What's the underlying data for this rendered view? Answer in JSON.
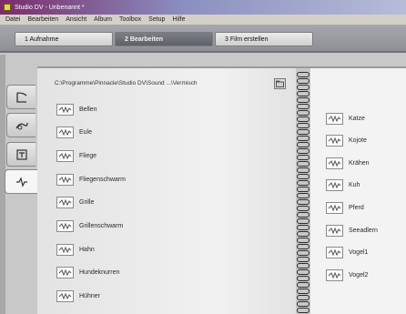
{
  "window": {
    "title": "Studio DV - Unbenannt *"
  },
  "menu": [
    "Datei",
    "Bearbeiten",
    "Ansicht",
    "Album",
    "Toolbox",
    "Setup",
    "Hilfe"
  ],
  "modes": [
    {
      "label": "1 Aufnahme",
      "active": false
    },
    {
      "label": "2 Bearbeiten",
      "active": true
    },
    {
      "label": "3 Film erstellen",
      "active": false
    }
  ],
  "album": {
    "path": "C:\\Programme\\Pinnacle\\Studio DV\\Sound ...\\Vermisch",
    "side_tabs": [
      "video-tab",
      "transitions-tab",
      "titles-tab",
      "sound-tab"
    ],
    "left_items": [
      "Bellen",
      "Eule",
      "Fliege",
      "Fliegenschwarm",
      "Grille",
      "Grillenschwarm",
      "Hahn",
      "Hundeknurren",
      "Hühner"
    ],
    "right_items": [
      "Katze",
      "Kojote",
      "Krähen",
      "Kuh",
      "Pferd",
      "Seeadlern",
      "Vogel1",
      "Vogel2"
    ]
  }
}
